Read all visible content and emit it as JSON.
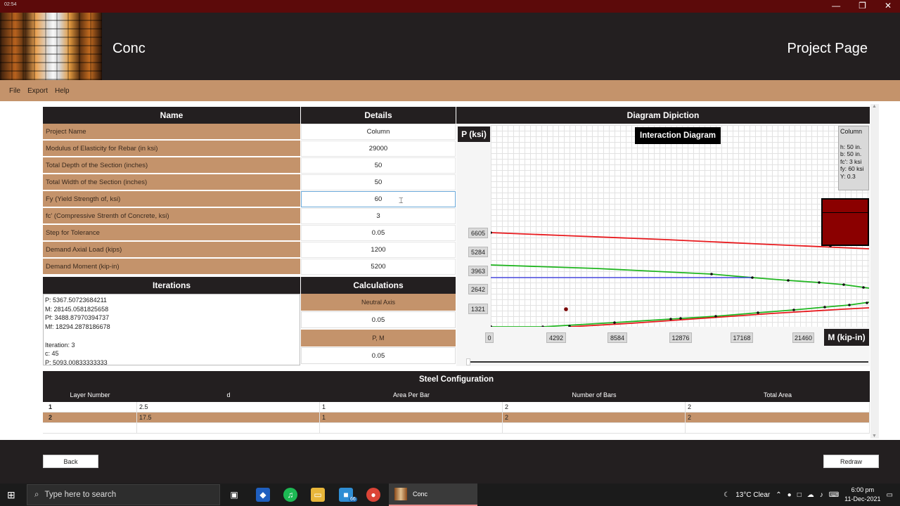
{
  "titlebar": {
    "recording_time": "02:54",
    "minimize": "—",
    "maximize": "❐",
    "close": "✕"
  },
  "header": {
    "app_title": "Conc",
    "page_title": "Project Page"
  },
  "menu": [
    "File",
    "Export",
    "Help"
  ],
  "project_table": {
    "name_header": "Name",
    "details_header": "Details",
    "rows": [
      {
        "name": "Project Name",
        "value": "Column"
      },
      {
        "name": "Modulus of Elasticity for Rebar (in ksi)",
        "value": "29000"
      },
      {
        "name": "Total Depth of the Section (inches)",
        "value": "50"
      },
      {
        "name": "Total Width of the Section (inches)",
        "value": "50"
      },
      {
        "name": "Fy (Yield Strength of, ksi)",
        "value": "60"
      },
      {
        "name": "fc' (Compressive Strenth of Concrete, ksi)",
        "value": "3"
      },
      {
        "name": "Step for Tolerance",
        "value": "0.05"
      },
      {
        "name": "Demand Axial Load (kips)",
        "value": "1200"
      },
      {
        "name": "Demand Moment (kip-in)",
        "value": "5200"
      }
    ]
  },
  "iterations": {
    "header": "Iterations",
    "lines": [
      "P: 5367.50723684211",
      "M: 28145.0581825658",
      "Pf: 3488.87970394737",
      "Mf: 18294.2878186678",
      "",
      "Iteration: 3",
      "c: 45",
      "P: 5093.00833333333"
    ]
  },
  "calculations": {
    "header": "Calculations",
    "neutral_axis_label": "Neutral Axis",
    "neutral_axis_value": "0.05",
    "pm_label": "P, M",
    "pm_value": "0.05"
  },
  "diagram": {
    "header": "Diagram Dipiction",
    "y_unit": "P (ksi)",
    "x_unit": "M (kip-in)",
    "title": "Interaction Diagram",
    "y_ticks": [
      "6605",
      "5284",
      "3963",
      "2642",
      "1321"
    ],
    "x_ticks": [
      "0",
      "4292",
      "8584",
      "12876",
      "17168",
      "21460"
    ],
    "info": {
      "name": "Column",
      "h": "h: 50 in.",
      "b": "b: 50 in.",
      "fc": "fc': 3 ksi",
      "fy": "fy: 60 ksi",
      "y": "Y: 0.3"
    },
    "colors": {
      "red": "#e8191d",
      "green": "#1fb51f",
      "blue": "#2a2adf",
      "section": "#8b0000"
    }
  },
  "steel_config": {
    "header": "Steel Configuration",
    "columns": [
      "Layer Number",
      "d",
      "Area Per Bar",
      "Number of Bars",
      "Total Area"
    ],
    "rows": [
      [
        "1",
        "2.5",
        "1",
        "2",
        "2"
      ],
      [
        "2",
        "17.5",
        "1",
        "2",
        "2"
      ]
    ]
  },
  "buttons": {
    "back": "Back",
    "redraw": "Redraw"
  },
  "taskbar": {
    "search_placeholder": "Type here to search",
    "app_label": "Conc",
    "badge": "66",
    "weather": "13°C  Clear",
    "time": "6:00 pm",
    "date": "11-Dec-2021"
  }
}
